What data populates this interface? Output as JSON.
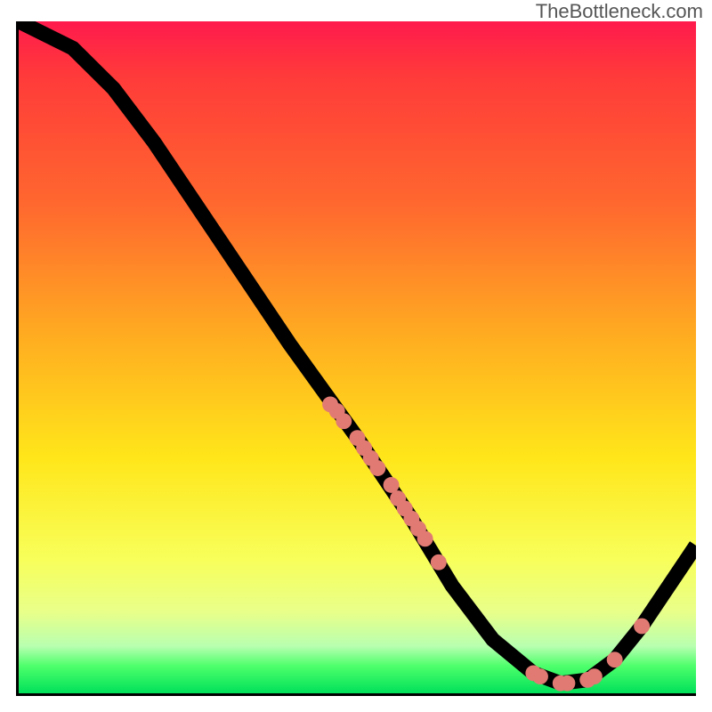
{
  "attribution": "TheBottleneck.com",
  "chart_data": {
    "type": "line",
    "title": "",
    "xlabel": "",
    "ylabel": "",
    "xlim": [
      0,
      100
    ],
    "ylim": [
      0,
      100
    ],
    "curve": [
      {
        "x": 0,
        "y": 100
      },
      {
        "x": 8,
        "y": 96
      },
      {
        "x": 14,
        "y": 90
      },
      {
        "x": 20,
        "y": 82
      },
      {
        "x": 30,
        "y": 67
      },
      {
        "x": 40,
        "y": 52
      },
      {
        "x": 50,
        "y": 38
      },
      {
        "x": 58,
        "y": 26
      },
      {
        "x": 64,
        "y": 16
      },
      {
        "x": 70,
        "y": 8
      },
      {
        "x": 76,
        "y": 3
      },
      {
        "x": 80,
        "y": 1.5
      },
      {
        "x": 84,
        "y": 2
      },
      {
        "x": 88,
        "y": 5
      },
      {
        "x": 92,
        "y": 10
      },
      {
        "x": 96,
        "y": 16
      },
      {
        "x": 100,
        "y": 22
      }
    ],
    "points": [
      {
        "x": 46,
        "y": 43
      },
      {
        "x": 47,
        "y": 42
      },
      {
        "x": 48,
        "y": 40.5
      },
      {
        "x": 50,
        "y": 38
      },
      {
        "x": 51,
        "y": 36.5
      },
      {
        "x": 52,
        "y": 35
      },
      {
        "x": 53,
        "y": 33.5
      },
      {
        "x": 55,
        "y": 31
      },
      {
        "x": 56,
        "y": 29
      },
      {
        "x": 57,
        "y": 27.5
      },
      {
        "x": 58,
        "y": 26
      },
      {
        "x": 59,
        "y": 24.5
      },
      {
        "x": 60,
        "y": 23
      },
      {
        "x": 62,
        "y": 19.5
      },
      {
        "x": 76,
        "y": 3
      },
      {
        "x": 77,
        "y": 2.5
      },
      {
        "x": 80,
        "y": 1.5
      },
      {
        "x": 81,
        "y": 1.5
      },
      {
        "x": 84,
        "y": 2
      },
      {
        "x": 85,
        "y": 2.5
      },
      {
        "x": 88,
        "y": 5
      },
      {
        "x": 92,
        "y": 10
      }
    ],
    "point_radius": 9,
    "background_gradient": {
      "top": "#ff1a4d",
      "mid1": "#ffb020",
      "mid2": "#ffe61a",
      "bottom": "#00e05a"
    }
  }
}
